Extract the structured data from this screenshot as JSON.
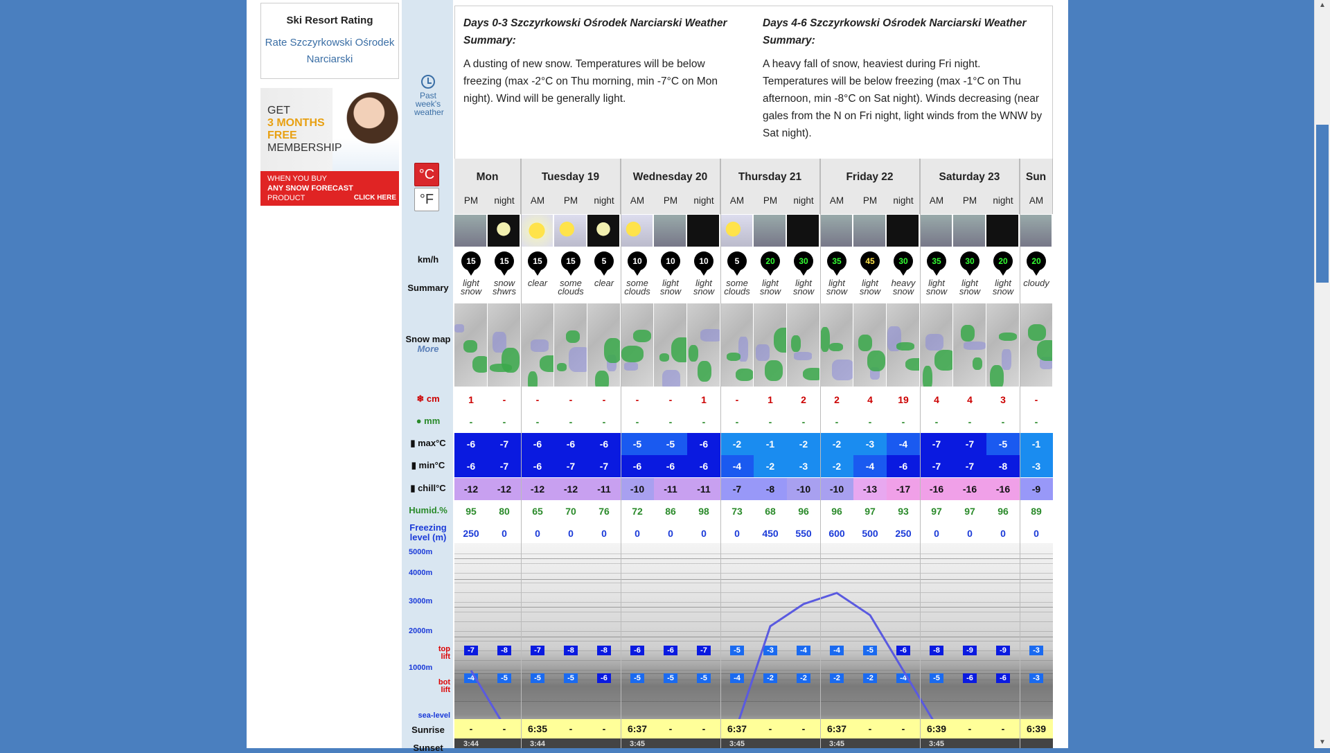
{
  "sidebar": {
    "rating_title": "Ski Resort Rating",
    "rating_link": "Rate Szczyrkowski Ośrodek Narciarski"
  },
  "ad": {
    "line1": "GET",
    "line2": "3 MONTHS",
    "line3": "FREE",
    "line4": "MEMBERSHIP",
    "line5": "WHEN YOU BUY",
    "line6": "ANY SNOW FORECAST",
    "line7": "PRODUCT",
    "click": "CLICK HERE"
  },
  "past": {
    "label": "Past week's weather"
  },
  "units": {
    "c": "°C",
    "f": "°F"
  },
  "summary": {
    "left_title": "Days 0-3 Szczyrkowski Ośrodek Narciarski Weather Summary:",
    "left_text": "A dusting of new snow. Temperatures will be below freezing (max -2°C on Thu morning, min -7°C on Mon night). Wind will be generally light.",
    "right_title": "Days 4-6 Szczyrkowski Ośrodek Narciarski Weather Summary:",
    "right_text": "A heavy fall of snow, heaviest during Fri night. Temperatures will be below freezing (max -1°C on Thu afternoon, min -8°C on Sat night). Winds decreasing (near gales from the N on Fri night, light winds from the WNW by Sat night)."
  },
  "labels": {
    "kmh": "km/h",
    "summary": "Summary",
    "snowmap": "Snow map",
    "more": "More",
    "cm": "cm",
    "mm": "mm",
    "max": "max°C",
    "min": "min°C",
    "chill": "chill°C",
    "humid": "Humid.%",
    "freezing": "Freezing level (m)",
    "sunrise": "Sunrise",
    "sunset": "Sunset",
    "toplift": "top lift",
    "botlift": "bot lift",
    "sealevel": "sea-level"
  },
  "altitudes": [
    "5000m",
    "4000m",
    "3000m",
    "2000m",
    "1000m"
  ],
  "days": [
    "Mon",
    "Tuesday 19",
    "Wednesday 20",
    "Thursday 21",
    "Friday 22",
    "Saturday 23",
    "Sun"
  ],
  "periods": [
    "PM",
    "night",
    "AM",
    "PM",
    "night",
    "AM",
    "PM",
    "night",
    "AM",
    "PM",
    "night",
    "AM",
    "PM",
    "night",
    "AM",
    "PM",
    "night",
    "AM"
  ],
  "wind": [
    "15",
    "15",
    "15",
    "15",
    "5",
    "10",
    "10",
    "10",
    "5",
    "20",
    "30",
    "35",
    "45",
    "30",
    "35",
    "30",
    "20",
    "20"
  ],
  "summaries": [
    [
      "light",
      "snow"
    ],
    [
      "snow",
      "shwrs"
    ],
    [
      "",
      "clear"
    ],
    [
      "some",
      "clouds"
    ],
    [
      "",
      "clear"
    ],
    [
      "some",
      "clouds"
    ],
    [
      "light",
      "snow"
    ],
    [
      "light",
      "snow"
    ],
    [
      "some",
      "clouds"
    ],
    [
      "light",
      "snow"
    ],
    [
      "light",
      "snow"
    ],
    [
      "light",
      "snow"
    ],
    [
      "light",
      "snow"
    ],
    [
      "heavy",
      "snow"
    ],
    [
      "light",
      "snow"
    ],
    [
      "light",
      "snow"
    ],
    [
      "light",
      "snow"
    ],
    [
      "",
      "cloudy"
    ]
  ],
  "snow_cm": [
    "1",
    "-",
    "-",
    "-",
    "-",
    "-",
    "-",
    "1",
    "-",
    "1",
    "2",
    "2",
    "4",
    "19",
    "4",
    "4",
    "3",
    "-"
  ],
  "rain_mm": [
    "-",
    "-",
    "-",
    "-",
    "-",
    "-",
    "-",
    "-",
    "-",
    "-",
    "-",
    "-",
    "-",
    "-",
    "-",
    "-",
    "-",
    "-"
  ],
  "max": [
    "-6",
    "-7",
    "-6",
    "-6",
    "-6",
    "-5",
    "-5",
    "-6",
    "-2",
    "-1",
    "-2",
    "-2",
    "-3",
    "-4",
    "-7",
    "-7",
    "-5",
    "-1"
  ],
  "min": [
    "-6",
    "-7",
    "-6",
    "-7",
    "-7",
    "-6",
    "-6",
    "-6",
    "-4",
    "-2",
    "-3",
    "-2",
    "-4",
    "-6",
    "-7",
    "-7",
    "-8",
    "-3"
  ],
  "chill": [
    "-12",
    "-12",
    "-12",
    "-12",
    "-11",
    "-10",
    "-11",
    "-11",
    "-7",
    "-8",
    "-10",
    "-10",
    "-13",
    "-17",
    "-16",
    "-16",
    "-16",
    "-9"
  ],
  "humid": [
    "95",
    "80",
    "65",
    "70",
    "76",
    "72",
    "86",
    "98",
    "73",
    "68",
    "96",
    "96",
    "97",
    "93",
    "97",
    "97",
    "96",
    "89"
  ],
  "freezing": [
    "250",
    "0",
    "0",
    "0",
    "0",
    "0",
    "0",
    "0",
    "0",
    "450",
    "550",
    "600",
    "500",
    "250",
    "0",
    "0",
    "0",
    "0"
  ],
  "top_lift": [
    "-7",
    "-8",
    "-7",
    "-8",
    "-8",
    "-6",
    "-6",
    "-7",
    "-5",
    "-3",
    "-4",
    "-4",
    "-5",
    "-6",
    "-8",
    "-9",
    "-9",
    "-3"
  ],
  "bot_lift": [
    "-4",
    "-5",
    "-5",
    "-5",
    "-6",
    "-5",
    "-5",
    "-5",
    "-4",
    "-2",
    "-2",
    "-2",
    "-2",
    "-4",
    "-5",
    "-6",
    "-6",
    "-3"
  ],
  "sunrise": [
    "-",
    "-",
    "6:35",
    "-",
    "-",
    "6:37",
    "-",
    "-",
    "6:37",
    "-",
    "-",
    "6:37",
    "-",
    "-",
    "6:39",
    "-",
    "-",
    "6:39"
  ],
  "sunset": [
    "3:44",
    "",
    "3:44",
    "",
    "",
    "3:45",
    "",
    "",
    "3:45",
    "",
    "",
    "3:45",
    "",
    "",
    "3:45",
    "",
    "",
    ""
  ]
}
